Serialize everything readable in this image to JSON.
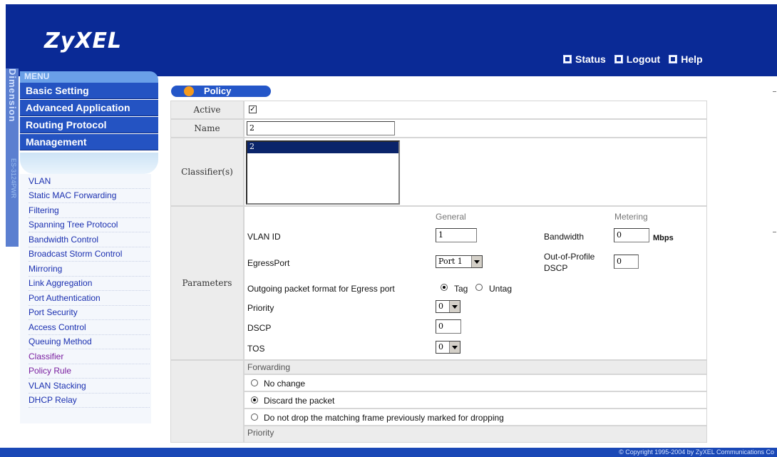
{
  "brand": {
    "logo": "ZyXEL",
    "vertical": "Dimension",
    "model": "ES-3124PWR"
  },
  "top_links": [
    {
      "label": "Status"
    },
    {
      "label": "Logout"
    },
    {
      "label": "Help"
    }
  ],
  "menu": {
    "header": "MENU",
    "items": [
      "Basic Setting",
      "Advanced Application",
      "Routing Protocol",
      "Management"
    ]
  },
  "subnav": [
    "VLAN",
    "Static MAC Forwarding",
    "Filtering",
    "Spanning Tree Protocol",
    "Bandwidth Control",
    "Broadcast Storm Control",
    "Mirroring",
    "Link Aggregation",
    "Port Authentication",
    "Port Security",
    "Access Control",
    "Queuing Method",
    "Classifier",
    "Policy Rule",
    "VLAN Stacking",
    "DHCP Relay"
  ],
  "page": {
    "title": "Policy",
    "rows": {
      "active_label": "Active",
      "active_checked": true,
      "name_label": "Name",
      "name_value": "2",
      "classifier_label": "Classifier(s)",
      "classifier_options": [
        "2"
      ],
      "parameters_label": "Parameters"
    },
    "parameters": {
      "general_header": "General",
      "metering_header": "Metering",
      "vlan_id_label": "VLAN ID",
      "vlan_id_value": "1",
      "egress_port_label": "EgressPort",
      "egress_port_value": "Port 1",
      "outgoing_label": "Outgoing packet format for Egress port",
      "tag_label": "Tag",
      "untag_label": "Untag",
      "tag_selected": "Tag",
      "priority_label": "Priority",
      "priority_value": "0",
      "dscp_label": "DSCP",
      "dscp_value": "0",
      "tos_label": "TOS",
      "tos_value": "0",
      "bandwidth_label": "Bandwidth",
      "bandwidth_value": "0",
      "bandwidth_unit": "Mbps",
      "oop_dscp_label_line1": "Out-of-Profile",
      "oop_dscp_label_line2": "DSCP",
      "oop_dscp_value": "0"
    },
    "forwarding": {
      "header": "Forwarding",
      "options": [
        "No change",
        "Discard the packet",
        "Do not drop the matching frame previously marked for dropping"
      ],
      "selected_index": 1
    },
    "priority_section_header": "Priority"
  },
  "footer": {
    "copyright": "© Copyright 1995-2004 by ZyXEL Communications Co"
  },
  "colors": {
    "header_blue": "#0a2a96",
    "menu_blue": "#2453c2",
    "accent_orange": "#f59a1d"
  }
}
